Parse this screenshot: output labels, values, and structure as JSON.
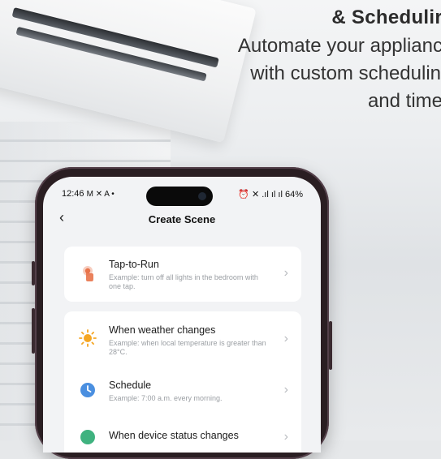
{
  "headline": {
    "title": "& Schedulir",
    "line1": "Automate your applianc",
    "line2": "with custom schedulin",
    "line3": "and time"
  },
  "status_bar": {
    "time": "12:46",
    "left_icons": "M ✕ A •",
    "right_icons": "⏰ ✕ .ıl ıl ıl 64%"
  },
  "nav": {
    "back_glyph": "‹",
    "title": "Create Scene"
  },
  "options": [
    {
      "title": "Tap-to-Run",
      "example": "Example: turn off all lights in the bedroom with one tap.",
      "icon": "tap-icon"
    },
    {
      "title": "When weather changes",
      "example": "Example: when local temperature is greater than 28°C.",
      "icon": "sun-icon"
    },
    {
      "title": "Schedule",
      "example": "Example: 7:00 a.m. every morning.",
      "icon": "clock-icon"
    },
    {
      "title": "When device status changes",
      "example": "",
      "icon": "device-icon"
    }
  ],
  "chevron": "›",
  "colors": {
    "tap_icon": "#e8734a",
    "sun_icon": "#f5a623",
    "clock_icon": "#4a8fe0",
    "device_icon": "#3fb27f"
  }
}
